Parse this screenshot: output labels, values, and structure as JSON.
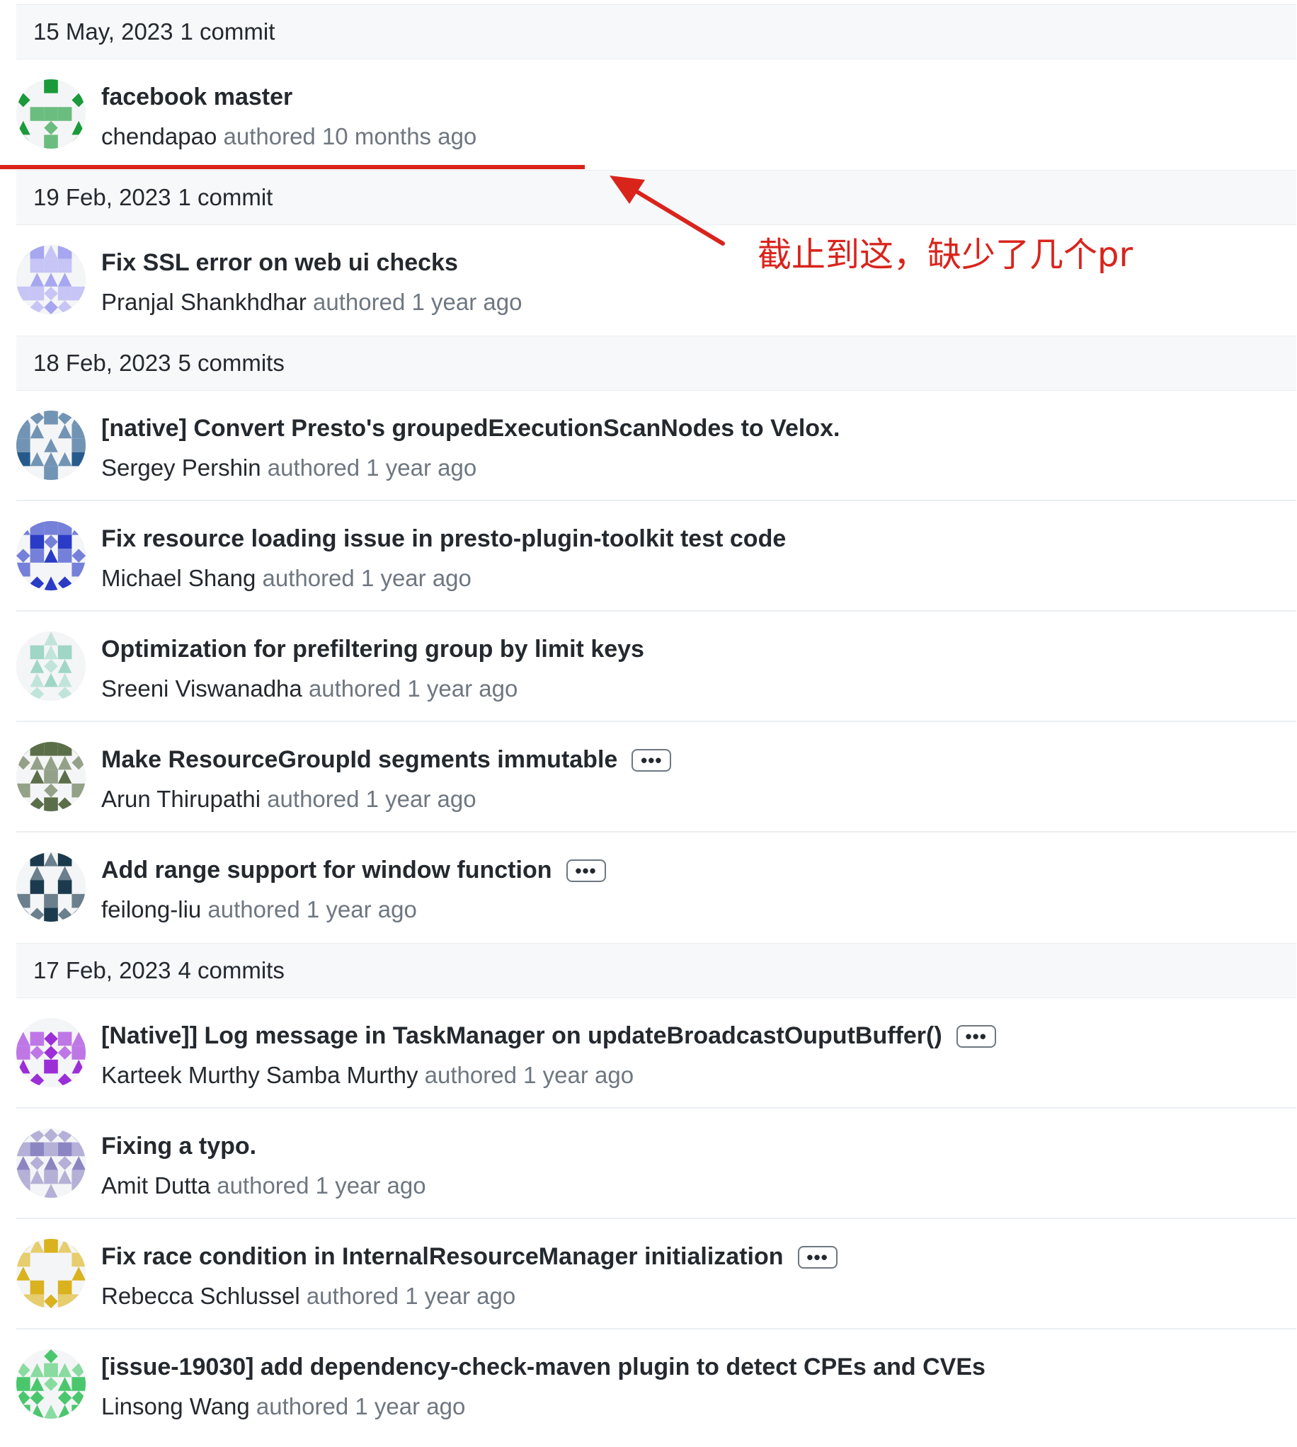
{
  "days": [
    {
      "date": "15 May, 2023",
      "count": "1 commit",
      "commits": [
        {
          "title": "facebook master",
          "author": "chendapao",
          "authored": "authored",
          "time": "10 months ago",
          "has_more": false,
          "avatar": {
            "color": "#1a9a3a",
            "icon": "identicon-green"
          }
        }
      ]
    },
    {
      "date": "19 Feb, 2023",
      "count": "1 commit",
      "commits": [
        {
          "title": "Fix SSL error on web ui checks",
          "author": "Pranjal Shankhdhar",
          "authored": "authored",
          "time": "1 year ago",
          "has_more": false,
          "avatar": {
            "color": "#a7a6f0",
            "icon": "identicon-lavender"
          }
        }
      ]
    },
    {
      "date": "18 Feb, 2023",
      "count": "5 commits",
      "commits": [
        {
          "title": "[native] Convert Presto's groupedExecutionScanNodes to Velox.",
          "author": "Sergey Pershin",
          "authored": "authored",
          "time": "1 year ago",
          "has_more": false,
          "avatar": {
            "color": "#265a8c",
            "icon": "identicon-darkblue"
          }
        },
        {
          "title": "Fix resource loading issue in presto-plugin-toolkit test code",
          "author": "Michael Shang",
          "authored": "authored",
          "time": "1 year ago",
          "has_more": false,
          "avatar": {
            "color": "#2a3bc6",
            "icon": "identicon-blue"
          }
        },
        {
          "title": "Optimization for prefiltering group by limit keys",
          "author": "Sreeni Viswanadha",
          "authored": "authored",
          "time": "1 year ago",
          "has_more": false,
          "avatar": {
            "color": "#9fd6c6",
            "icon": "identicon-mint"
          }
        },
        {
          "title": "Make ResourceGroupId segments immutable",
          "author": "Arun Thirupathi",
          "authored": "authored",
          "time": "1 year ago",
          "has_more": true,
          "avatar": {
            "color": "#5b6e4a",
            "icon": "identicon-olive"
          }
        },
        {
          "title": "Add range support for window function",
          "author": "feilong-liu",
          "authored": "authored",
          "time": "1 year ago",
          "has_more": true,
          "avatar": {
            "color": "#1b3a4e",
            "icon": "identicon-navy"
          }
        }
      ]
    },
    {
      "date": "17 Feb, 2023",
      "count": "4 commits",
      "commits": [
        {
          "title": "[Native]] Log message in TaskManager on updateBroadcastOuputBuffer()",
          "author": "Karteek Murthy Samba Murthy",
          "authored": "authored",
          "time": "1 year ago",
          "has_more": true,
          "avatar": {
            "color": "#9c2ed8",
            "icon": "identicon-purple"
          }
        },
        {
          "title": "Fixing a typo.",
          "author": "Amit Dutta",
          "authored": "authored",
          "time": "1 year ago",
          "has_more": false,
          "avatar": {
            "color": "#8b86c2",
            "icon": "identicon-periwinkle"
          }
        },
        {
          "title": "Fix race condition in InternalResourceManager initialization",
          "author": "Rebecca Schlussel",
          "authored": "authored",
          "time": "1 year ago",
          "has_more": true,
          "avatar": {
            "color": "#d9b21e",
            "icon": "identicon-gold"
          }
        },
        {
          "title": "[issue-19030] add dependency-check-maven plugin to detect CPEs and CVEs",
          "author": "Linsong Wang",
          "authored": "authored",
          "time": "1 year ago",
          "has_more": false,
          "avatar": {
            "color": "#4ac76d",
            "icon": "identicon-lightgreen"
          }
        }
      ]
    }
  ],
  "more_button": {
    "label": "•••",
    "icon": "ellipsis-icon"
  },
  "annotation": {
    "note": "截止到这，缺少了几个pr",
    "color": "#d9241c"
  }
}
